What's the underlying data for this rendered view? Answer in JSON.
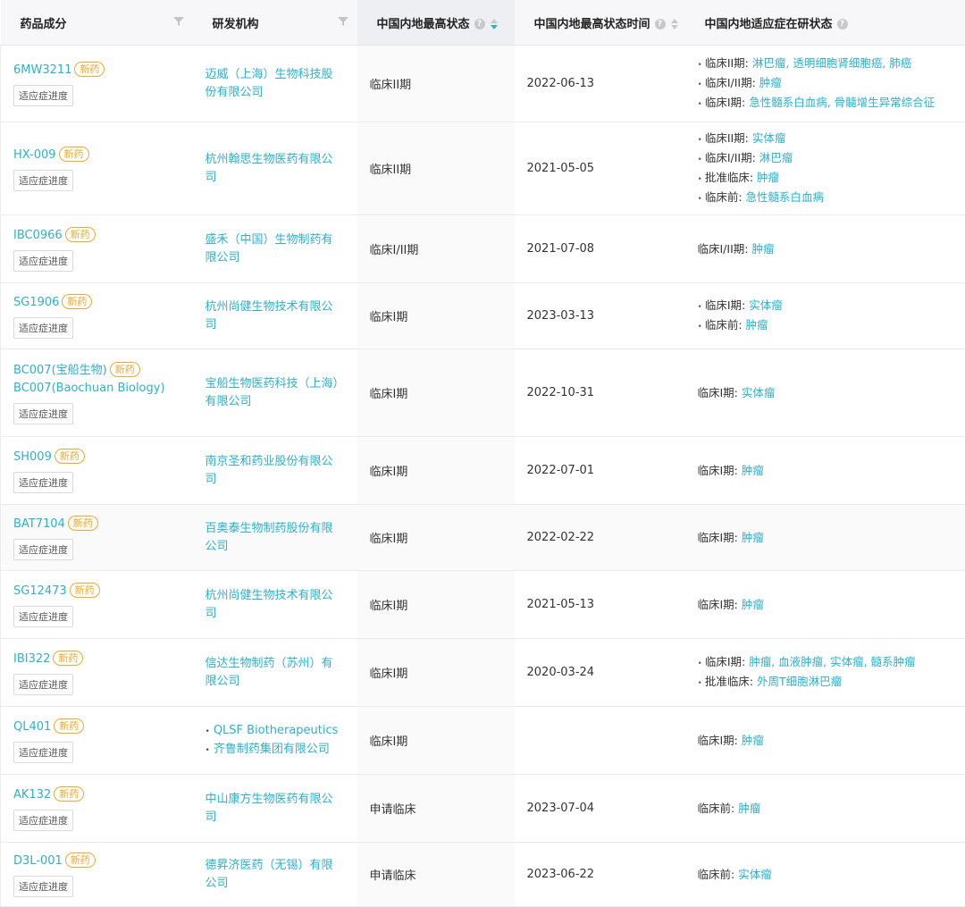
{
  "header": {
    "drug": "药品成分",
    "org": "研发机构",
    "status": "中国内地最高状态",
    "status_date": "中国内地最高状态时间",
    "indications": "中国内地适应症在研状态"
  },
  "icons": {
    "filter": "filter-icon",
    "help": "question-circle-icon",
    "sort": "sort-caret-icon"
  },
  "colors": {
    "link": "#2ab2cf",
    "badge": "#f0a92c",
    "header_bg": "#f7f7f9"
  },
  "badge_label": "新药",
  "progress_label": "适应症进度",
  "rows": [
    {
      "drug": "6MW3211",
      "drug2": "",
      "org": [
        "迈威（上海）生物科技股份有限公司"
      ],
      "status": "临床II期",
      "date": "2022-06-13",
      "indications": [
        {
          "phase": "临床II期: ",
          "items": "淋巴瘤, 透明细胞肾细胞癌, 肺癌"
        },
        {
          "phase": "临床I/II期: ",
          "items": "肿瘤"
        },
        {
          "phase": "临床I期: ",
          "items": "急性髓系白血病, 骨髓增生异常综合征"
        }
      ]
    },
    {
      "drug": "HX-009",
      "drug2": "",
      "org": [
        "杭州翰思生物医药有限公司"
      ],
      "status": "临床II期",
      "date": "2021-05-05",
      "indications": [
        {
          "phase": "临床II期: ",
          "items": "实体瘤"
        },
        {
          "phase": "临床I/II期: ",
          "items": "淋巴瘤"
        },
        {
          "phase": "批准临床: ",
          "items": "肿瘤"
        },
        {
          "phase": "临床前: ",
          "items": "急性髓系白血病"
        }
      ]
    },
    {
      "drug": "IBC0966",
      "drug2": "",
      "org": [
        "盛禾（中国）生物制药有限公司"
      ],
      "status": "临床I/II期",
      "date": "2021-07-08",
      "indications": [
        {
          "phase": "临床I/II期: ",
          "items": "肿瘤"
        }
      ]
    },
    {
      "drug": "SG1906",
      "drug2": "",
      "org": [
        "杭州尚健生物技术有限公司"
      ],
      "status": "临床I期",
      "date": "2023-03-13",
      "indications": [
        {
          "phase": "临床I期: ",
          "items": "实体瘤"
        },
        {
          "phase": "临床前: ",
          "items": "肿瘤"
        }
      ]
    },
    {
      "drug": "BC007(宝船生物)",
      "drug2": "BC007(Baochuan Biology)",
      "org": [
        "宝船生物医药科技（上海）有限公司"
      ],
      "status": "临床I期",
      "date": "2022-10-31",
      "indications": [
        {
          "phase": "临床I期: ",
          "items": "实体瘤"
        }
      ]
    },
    {
      "drug": "SH009",
      "drug2": "",
      "org": [
        "南京圣和药业股份有限公司"
      ],
      "status": "临床I期",
      "date": "2022-07-01",
      "indications": [
        {
          "phase": "临床I期: ",
          "items": "肿瘤"
        }
      ]
    },
    {
      "drug": "BAT7104",
      "drug2": "",
      "org": [
        "百奥泰生物制药股份有限公司"
      ],
      "status": "临床I期",
      "date": "2022-02-22",
      "indications": [
        {
          "phase": "临床I期: ",
          "items": "肿瘤"
        }
      ]
    },
    {
      "drug": "SG12473",
      "drug2": "",
      "org": [
        "杭州尚健生物技术有限公司"
      ],
      "status": "临床I期",
      "date": "2021-05-13",
      "indications": [
        {
          "phase": "临床I期: ",
          "items": "肿瘤"
        }
      ]
    },
    {
      "drug": "IBI322",
      "drug2": "",
      "org": [
        "信达生物制药（苏州）有限公司"
      ],
      "status": "临床I期",
      "date": "2020-03-24",
      "indications": [
        {
          "phase": "临床I期: ",
          "items": "肿瘤, 血液肿瘤, 实体瘤, 髓系肿瘤"
        },
        {
          "phase": "批准临床: ",
          "items": "外周T细胞淋巴瘤"
        }
      ]
    },
    {
      "drug": "QL401",
      "drug2": "",
      "org": [
        "QLSF Biotherapeutics",
        "齐鲁制药集团有限公司"
      ],
      "status": "临床I期",
      "date": "",
      "indications": [
        {
          "phase": "临床I期: ",
          "items": "肿瘤"
        }
      ]
    },
    {
      "drug": "AK132",
      "drug2": "",
      "org": [
        "中山康方生物医药有限公司"
      ],
      "status": "申请临床",
      "date": "2023-07-04",
      "indications": [
        {
          "phase": "临床前: ",
          "items": "肿瘤"
        }
      ]
    },
    {
      "drug": "D3L-001",
      "drug2": "",
      "org": [
        "德昇济医药（无锡）有限公司"
      ],
      "status": "申请临床",
      "date": "2023-06-22",
      "indications": [
        {
          "phase": "临床前: ",
          "items": "实体瘤"
        }
      ]
    }
  ]
}
